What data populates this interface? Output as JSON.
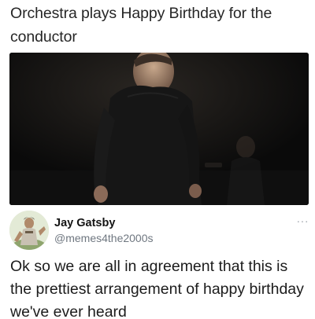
{
  "post": {
    "caption": "Orchestra plays Happy Birthday for the conductor"
  },
  "video": {
    "icon": "video-frame"
  },
  "tweet": {
    "display_name": "Jay Gatsby",
    "handle": "@memes4the2000s",
    "more_icon": "more-horizontal-icon",
    "more_glyph": "···",
    "text": "Ok so we are all in agreement that this is the prettiest arrangement of happy birthday we've ever heard"
  },
  "colors": {
    "text": "#1c1c1c",
    "secondary_text": "#6f7780",
    "video_background": "#0c0c0c"
  }
}
